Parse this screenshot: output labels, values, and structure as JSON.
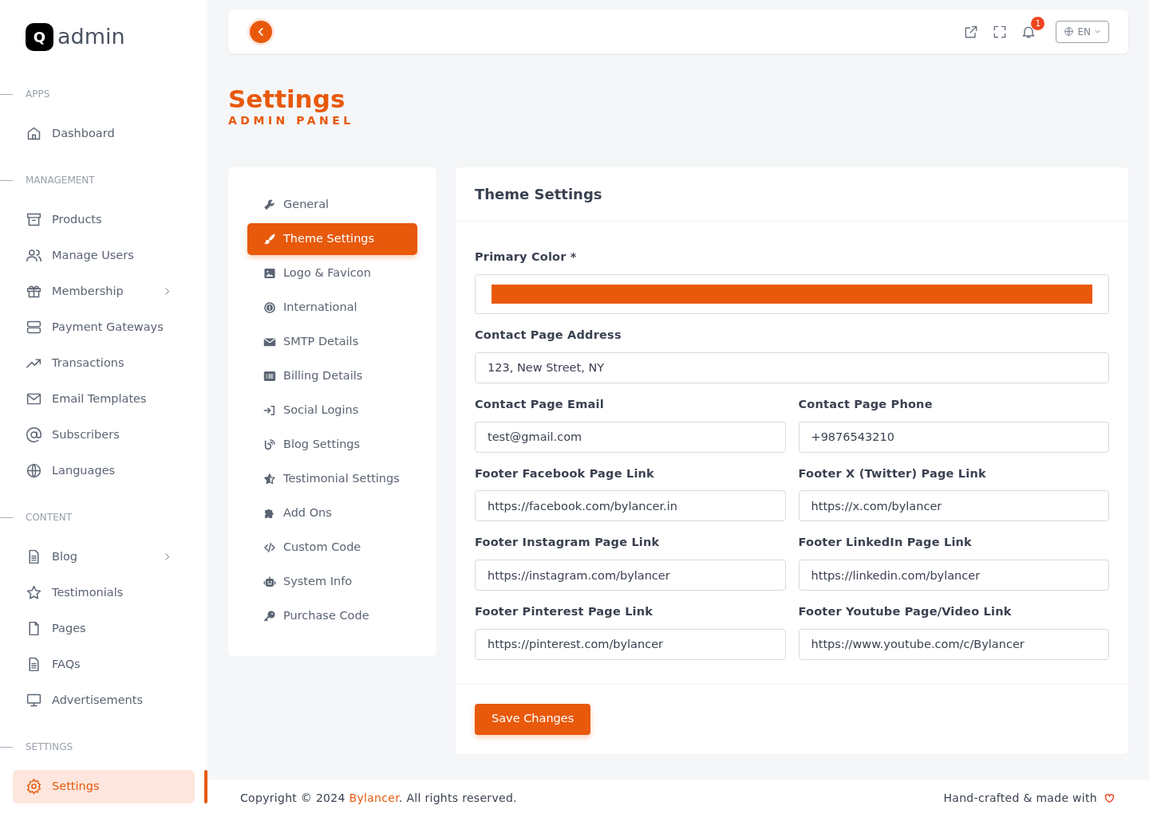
{
  "brand": {
    "name": "admin",
    "logo_letter": "Q"
  },
  "sidebar": {
    "sections": [
      {
        "title": "APPS",
        "items": [
          {
            "label": "Dashboard",
            "selected": false,
            "has_submenu": false
          }
        ]
      },
      {
        "title": "MANAGEMENT",
        "items": [
          {
            "label": "Products",
            "selected": false,
            "has_submenu": false
          },
          {
            "label": "Manage Users",
            "selected": false,
            "has_submenu": false
          },
          {
            "label": "Membership",
            "selected": false,
            "has_submenu": true
          },
          {
            "label": "Payment Gateways",
            "selected": false,
            "has_submenu": false
          },
          {
            "label": "Transactions",
            "selected": false,
            "has_submenu": false
          },
          {
            "label": "Email Templates",
            "selected": false,
            "has_submenu": false
          },
          {
            "label": "Subscribers",
            "selected": false,
            "has_submenu": false
          },
          {
            "label": "Languages",
            "selected": false,
            "has_submenu": false
          }
        ]
      },
      {
        "title": "CONTENT",
        "items": [
          {
            "label": "Blog",
            "selected": false,
            "has_submenu": true
          },
          {
            "label": "Testimonials",
            "selected": false,
            "has_submenu": false
          },
          {
            "label": "Pages",
            "selected": false,
            "has_submenu": false
          },
          {
            "label": "FAQs",
            "selected": false,
            "has_submenu": false
          },
          {
            "label": "Advertisements",
            "selected": false,
            "has_submenu": false
          }
        ]
      },
      {
        "title": "SETTINGS",
        "items": [
          {
            "label": "Settings",
            "selected": true,
            "has_submenu": false
          }
        ]
      }
    ]
  },
  "topbar": {
    "notification_count": "1",
    "language": "EN"
  },
  "page": {
    "title": "Settings",
    "subtitle": "ADMIN PANEL"
  },
  "settings_menu": [
    {
      "label": "General",
      "selected": false
    },
    {
      "label": "Theme Settings",
      "selected": true
    },
    {
      "label": "Logo & Favicon",
      "selected": false
    },
    {
      "label": "International",
      "selected": false
    },
    {
      "label": "SMTP Details",
      "selected": false
    },
    {
      "label": "Billing Details",
      "selected": false
    },
    {
      "label": "Social Logins",
      "selected": false
    },
    {
      "label": "Blog Settings",
      "selected": false
    },
    {
      "label": "Testimonial Settings",
      "selected": false
    },
    {
      "label": "Add Ons",
      "selected": false
    },
    {
      "label": "Custom Code",
      "selected": false
    },
    {
      "label": "System Info",
      "selected": false
    },
    {
      "label": "Purchase Code",
      "selected": false
    }
  ],
  "form": {
    "title": "Theme Settings",
    "rows": [
      [
        {
          "kind": "color",
          "label": "Primary Color *",
          "color": "#e8590c"
        }
      ],
      [
        {
          "kind": "text",
          "label": "Contact Page Address",
          "value": "123, New Street, NY"
        }
      ],
      [
        {
          "kind": "text",
          "label": "Contact Page Email",
          "value": "test@gmail.com"
        },
        {
          "kind": "text",
          "label": "Contact Page Phone",
          "value": "+9876543210"
        }
      ],
      [
        {
          "kind": "text",
          "label": "Footer Facebook Page Link",
          "value": "https://facebook.com/bylancer.in"
        },
        {
          "kind": "text",
          "label": "Footer X (Twitter) Page Link",
          "value": "https://x.com/bylancer"
        }
      ],
      [
        {
          "kind": "text",
          "label": "Footer Instagram Page Link",
          "value": "https://instagram.com/bylancer"
        },
        {
          "kind": "text",
          "label": "Footer LinkedIn Page Link",
          "value": "https://linkedin.com/bylancer"
        }
      ],
      [
        {
          "kind": "text",
          "label": "Footer Pinterest Page Link",
          "value": "https://pinterest.com/bylancer"
        },
        {
          "kind": "text",
          "label": "Footer Youtube Page/Video Link",
          "value": "https://www.youtube.com/c/Bylancer"
        }
      ]
    ],
    "submit": "Save Changes"
  },
  "footer": {
    "copyright": "Copyright © 2024 ",
    "link": "Bylancer",
    "rights": ". All rights reserved.",
    "credit": "Hand-crafted & made with"
  }
}
